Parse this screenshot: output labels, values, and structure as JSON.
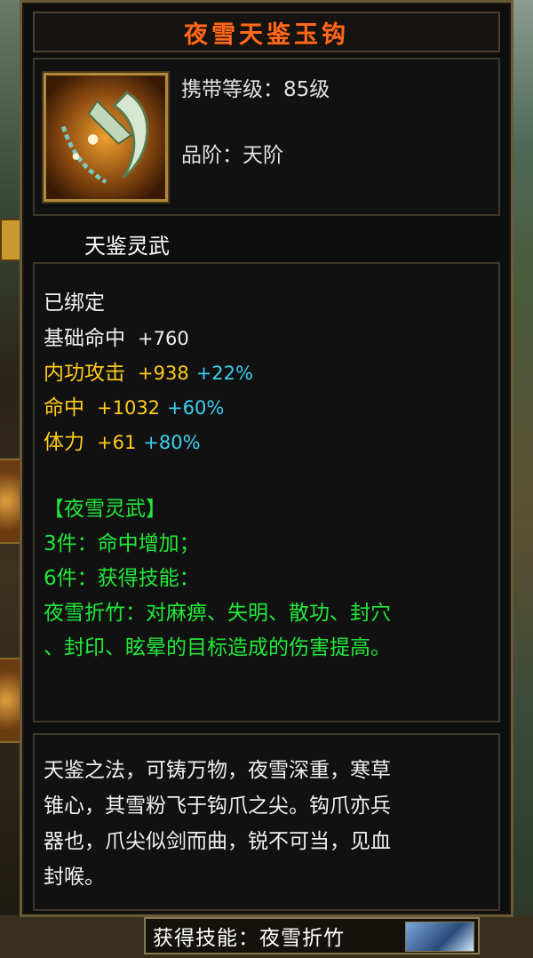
{
  "item": {
    "name": "夜雪天鉴玉钩",
    "level_label": "携带等级：85级",
    "grade_label": "品阶：天阶",
    "subtitle": "天鉴灵武"
  },
  "stats": {
    "bound": "已绑定",
    "lines": [
      {
        "label": "基础命中",
        "value": "+760",
        "pct": "",
        "color": "#f0f0f0"
      },
      {
        "label": "内功攻击",
        "value": "+938",
        "pct": "+22%",
        "color": "#ffcc1a"
      },
      {
        "label": "命中",
        "value": "+1032",
        "pct": "+60%",
        "color": "#ffcc1a"
      },
      {
        "label": "体力",
        "value": "+61",
        "pct": "+80%",
        "color": "#ffcc1a"
      }
    ]
  },
  "set": {
    "name": "【夜雪灵武】",
    "piece3": "3件：命中增加；",
    "piece6": "6件：获得技能：",
    "skill_desc_1": "夜雪折竹：对麻痹、失明、散功、封穴",
    "skill_desc_2": "、封印、眩晕的目标造成的伤害提高。"
  },
  "description": {
    "line1": "天鉴之法，可铸万物，夜雪深重，寒草",
    "line2": "锥心，其雪粉飞于钩爪之尖。钩爪亦兵",
    "line3": "器也，爪尖似剑而曲，锐不可当，见血",
    "line4": "封喉。"
  },
  "skill_bar": {
    "label": "获得技能：夜雪折竹"
  },
  "icons": {
    "item_icon": "jade-hook-weapon-icon",
    "skill_icon": "snow-bamboo-skill-icon"
  },
  "colors": {
    "title": "#ff6a1a",
    "yellow_stat": "#ffcc1a",
    "percent": "#3cd0f0",
    "set_green": "#22e83a"
  }
}
